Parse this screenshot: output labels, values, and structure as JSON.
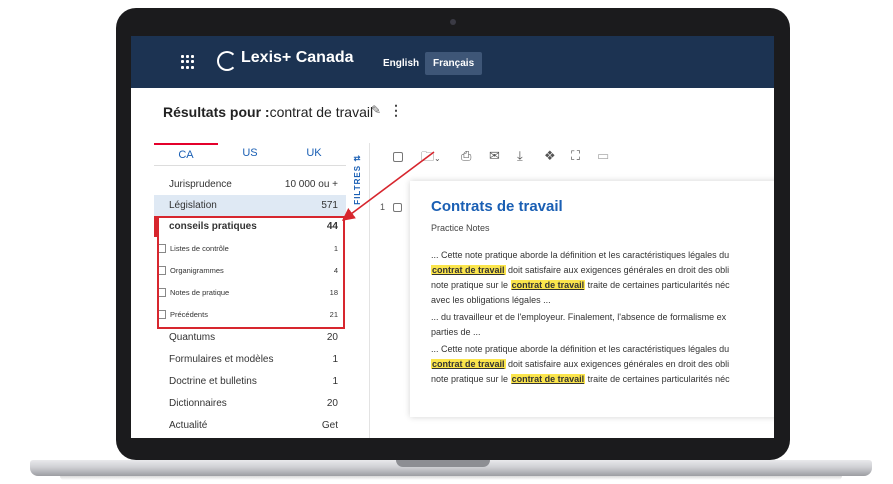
{
  "header": {
    "brand": "Lexis+",
    "brand_suffix": "Canada",
    "lang_english": "English",
    "lang_french": "Français"
  },
  "results": {
    "prefix": "Résultats pour :",
    "query": "contrat de travail"
  },
  "jurisdiction_tabs": [
    "CA",
    "US",
    "UK"
  ],
  "categories": [
    {
      "label": "Jurisprudence",
      "count": "10 000 ou +"
    },
    {
      "label": "Législation",
      "count": "571"
    },
    {
      "label": "conseils pratiques",
      "count": "44"
    },
    {
      "label": "Listes de contrôle",
      "count": "1"
    },
    {
      "label": "Organigrammes",
      "count": "4"
    },
    {
      "label": "Notes de pratique",
      "count": "18"
    },
    {
      "label": "Précédents",
      "count": "21"
    },
    {
      "label": "Quantums",
      "count": "20"
    },
    {
      "label": "Formulaires et modèles",
      "count": "1"
    },
    {
      "label": "Doctrine et bulletins",
      "count": "1"
    },
    {
      "label": "Dictionnaires",
      "count": "20"
    },
    {
      "label": "Actualité",
      "count": "Get"
    }
  ],
  "filters_label": "FILTRES",
  "result": {
    "number": "1",
    "title": "Contrats de travail",
    "type": "Practice Notes",
    "snippets": [
      [
        "... Cette note pratique aborde la définition et les caractéristiques légales du",
        "",
        ""
      ],
      [
        "",
        "contrat de travail",
        " doit satisfaire aux exigences générales en droit des obli"
      ],
      [
        "note pratique sur le ",
        "contrat de travail",
        " traite de certaines particularités néc"
      ],
      [
        "avec les obligations légales ...",
        "",
        ""
      ],
      [
        "... du travailleur et de l'employeur. Finalement, l'absence de formalisme ex",
        "",
        ""
      ],
      [
        "parties de ...",
        "",
        ""
      ],
      [
        "... Cette note pratique aborde la définition et les caractéristiques légales du",
        "",
        ""
      ],
      [
        "",
        "contrat de travail",
        " doit satisfaire aux exigences générales en droit des obli"
      ],
      [
        "note pratique sur le ",
        "contrat de travail",
        " traite de certaines particularités néc"
      ]
    ]
  },
  "colors": {
    "navy": "#1c3352",
    "accent_red": "#d7262e",
    "link_blue": "#1a5fb4",
    "highlight": "#fbe54c"
  }
}
